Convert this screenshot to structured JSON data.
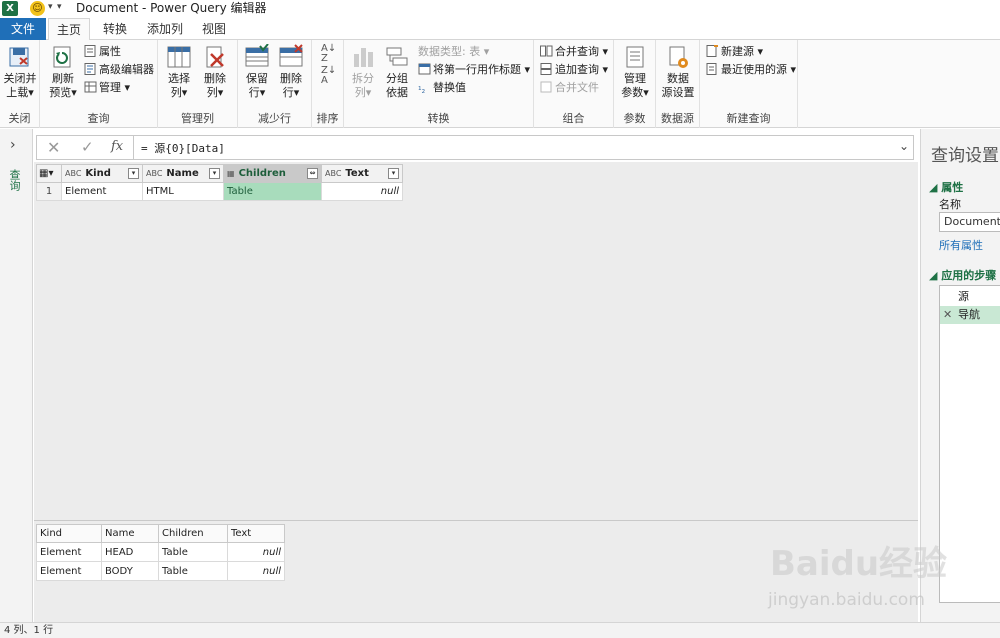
{
  "window": {
    "title": "Document - Power Query 编辑器",
    "app_icon": "excel-icon",
    "smiley_icon": "feedback-smiley-icon"
  },
  "tabs": [
    "文件",
    "主页",
    "转换",
    "添加列",
    "视图"
  ],
  "ribbon": {
    "close": {
      "label1": "关闭并",
      "label2": "上载",
      "group": "关闭"
    },
    "query": {
      "refresh1": "刷新",
      "refresh2": "预览",
      "properties": "属性",
      "advanced_editor": "高级编辑器",
      "manage": "管理",
      "group": "查询"
    },
    "manage_columns": {
      "choose1": "选择",
      "choose2": "列",
      "remove1": "删除",
      "remove2": "列",
      "group": "管理列"
    },
    "reduce_rows": {
      "keep1": "保留",
      "keep2": "行",
      "remove1": "删除",
      "remove2": "行",
      "group": "减少行"
    },
    "sort": {
      "group": "排序"
    },
    "transform": {
      "split1": "拆分",
      "split2": "列",
      "groupby1": "分组",
      "groupby2": "依据",
      "data_type": "数据类型: 表",
      "first_row_header": "将第一行用作标题",
      "replace_values": "替换值",
      "group": "转换"
    },
    "combine": {
      "merge": "合并查询",
      "append": "追加查询",
      "combine_files": "合并文件",
      "group": "组合"
    },
    "params": {
      "label1": "管理",
      "label2": "参数",
      "group": "参数"
    },
    "datasource": {
      "label1": "数据",
      "label2": "源设置",
      "group": "数据源"
    },
    "newquery": {
      "new_source": "新建源",
      "recent_sources": "最近使用的源",
      "group": "新建查询"
    }
  },
  "left_pane": {
    "label": "查询"
  },
  "formula_bar": {
    "cancel": "✕",
    "confirm": "✓",
    "fx": "fx",
    "formula": "= 源{0}[Data]"
  },
  "grid": {
    "columns": [
      {
        "type": "ABC",
        "name": "Kind"
      },
      {
        "type": "ABC",
        "name": "Name"
      },
      {
        "type": "table",
        "name": "Children"
      },
      {
        "type": "ABC",
        "name": "Text"
      }
    ],
    "rows": [
      {
        "num": "1",
        "cells": [
          "Element",
          "HTML",
          "Table",
          "null"
        ]
      }
    ]
  },
  "preview": {
    "headers": [
      "Kind",
      "Name",
      "Children",
      "Text"
    ],
    "rows": [
      [
        "Element",
        "HEAD",
        "Table",
        "null"
      ],
      [
        "Element",
        "BODY",
        "Table",
        "null"
      ]
    ]
  },
  "right_pane": {
    "title": "查询设置",
    "properties_section": "属性",
    "name_label": "名称",
    "name_value": "Document",
    "all_properties": "所有属性",
    "steps_section": "应用的步骤",
    "steps": [
      "源",
      "导航"
    ]
  },
  "status": {
    "text": "4 列、1 行"
  },
  "watermark": {
    "logo": "Baidu经验",
    "url": "jingyan.baidu.com"
  },
  "colors": {
    "accent_green": "#1e7145",
    "file_tab_blue": "#1f6fb8",
    "selected_col": "#a8dcbc"
  }
}
